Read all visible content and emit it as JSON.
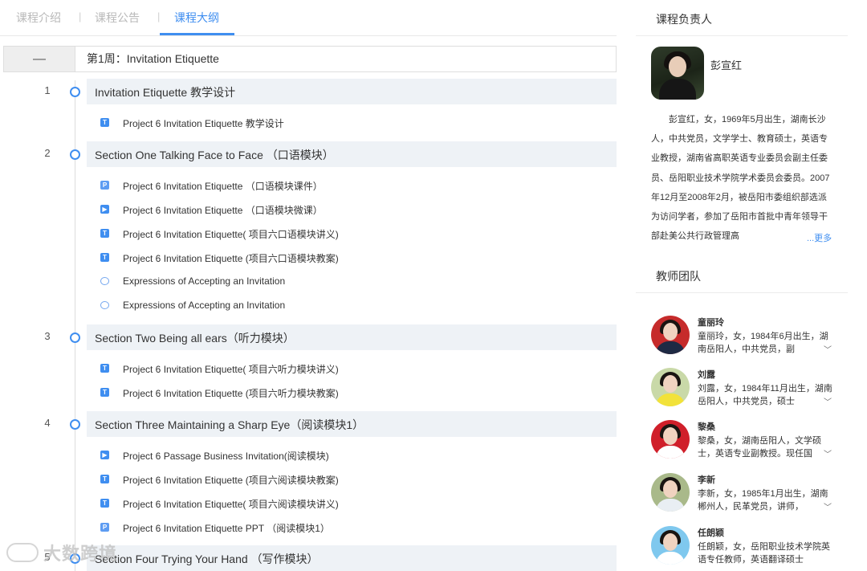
{
  "tabs": [
    {
      "label": "课程介绍"
    },
    {
      "label": "课程公告"
    },
    {
      "label": "课程大纲"
    }
  ],
  "tab_separator": "|",
  "week": {
    "collapse_symbol": "—",
    "title": "第1周：Invitation Etiquette"
  },
  "sections": [
    {
      "num": "1",
      "title": "Invitation Etiquette 教学设计",
      "items": [
        {
          "type": "text",
          "icon_letter": "T",
          "label": "Project 6 Invitation Etiquette 教学设计"
        }
      ]
    },
    {
      "num": "2",
      "title": "Section One Talking Face to Face （口语模块）",
      "items": [
        {
          "type": "ppt",
          "icon_letter": "P",
          "label": "Project 6 Invitation Etiquette （口语模块课件）"
        },
        {
          "type": "video",
          "icon_letter": "▶",
          "label": "Project 6 Invitation Etiquette （口语模块微课）"
        },
        {
          "type": "text",
          "icon_letter": "T",
          "label": "Project 6 Invitation Etiquette( 项目六口语模块讲义)"
        },
        {
          "type": "text",
          "icon_letter": "T",
          "label": "Project 6 Invitation Etiquette (项目六口语模块教案)"
        },
        {
          "type": "discuss",
          "icon_letter": "",
          "label": "Expressions of Accepting an Invitation"
        },
        {
          "type": "discuss",
          "icon_letter": "",
          "label": "Expressions of Accepting an Invitation"
        }
      ]
    },
    {
      "num": "3",
      "title": "Section Two Being all ears（听力模块）",
      "items": [
        {
          "type": "text",
          "icon_letter": "T",
          "label": "Project 6 Invitation Etiquette( 项目六听力模块讲义)"
        },
        {
          "type": "text",
          "icon_letter": "T",
          "label": "Project 6 Invitation Etiquette (项目六听力模块教案)"
        }
      ]
    },
    {
      "num": "4",
      "title": "Section Three Maintaining a Sharp Eye（阅读模块1）",
      "items": [
        {
          "type": "video",
          "icon_letter": "▶",
          "label": "Project 6 Passage Business Invitation(阅读模块)"
        },
        {
          "type": "text",
          "icon_letter": "T",
          "label": "Project 6 Invitation Etiquette (项目六阅读模块教案)"
        },
        {
          "type": "text",
          "icon_letter": "T",
          "label": "Project 6 Invitation Etiquette( 项目六阅读模块讲义)"
        },
        {
          "type": "ppt",
          "icon_letter": "P",
          "label": "Project 6 Invitation Etiquette PPT （阅读模块1）"
        }
      ]
    },
    {
      "num": "5",
      "title": "Section Four Trying Your Hand （写作模块）",
      "items": []
    }
  ],
  "course_leader": {
    "heading": "课程负责人",
    "name": "彭宣红",
    "bio": "彭宣红，女，1969年5月出生，湖南长沙人，中共党员，文学学士、教育硕士，英语专业教授，湖南省高职英语专业委员会副主任委员、岳阳职业技术学院学术委员会委员。2007年12月至2008年2月，被岳阳市委组织部选派为访问学者，参加了岳阳市首批中青年领导干部赴美公共行政管理高",
    "more": "...更多"
  },
  "team": {
    "heading": "教师团队",
    "members": [
      {
        "name": "童丽玲",
        "desc": "童丽玲，女，1984年6月出生，湖南岳阳人，中共党员，副",
        "bg": "#c62b2b",
        "shirt": "#1f2a44"
      },
      {
        "name": "刘露",
        "desc": "刘露，女，1984年11月出生，湖南岳阳人，中共党员，硕士",
        "bg": "#c9d9a8",
        "shirt": "#f2e23a"
      },
      {
        "name": "黎桑",
        "desc": "黎桑，女，湖南岳阳人，文学硕士，英语专业副教授。现任国",
        "bg": "#d01f2a",
        "shirt": "#ffffff"
      },
      {
        "name": "李新",
        "desc": "李新，女，1985年1月出生，湖南郴州人，民革党员，讲师，",
        "bg": "#a9b98a",
        "shirt": "#e9eef3"
      },
      {
        "name": "任朗颖",
        "desc": "任朗颖，女，岳阳职业技术学院英语专任教师，英语翻译硕士",
        "bg": "#7fc8ee",
        "shirt": "#ffffff"
      }
    ],
    "expand_symbol": "﹀"
  },
  "watermark": {
    "text": "大数跨境"
  },
  "colors": {
    "accent": "#3f8ef0",
    "section_bg": "#eef2f6",
    "muted_tab": "#b9b9b9"
  }
}
